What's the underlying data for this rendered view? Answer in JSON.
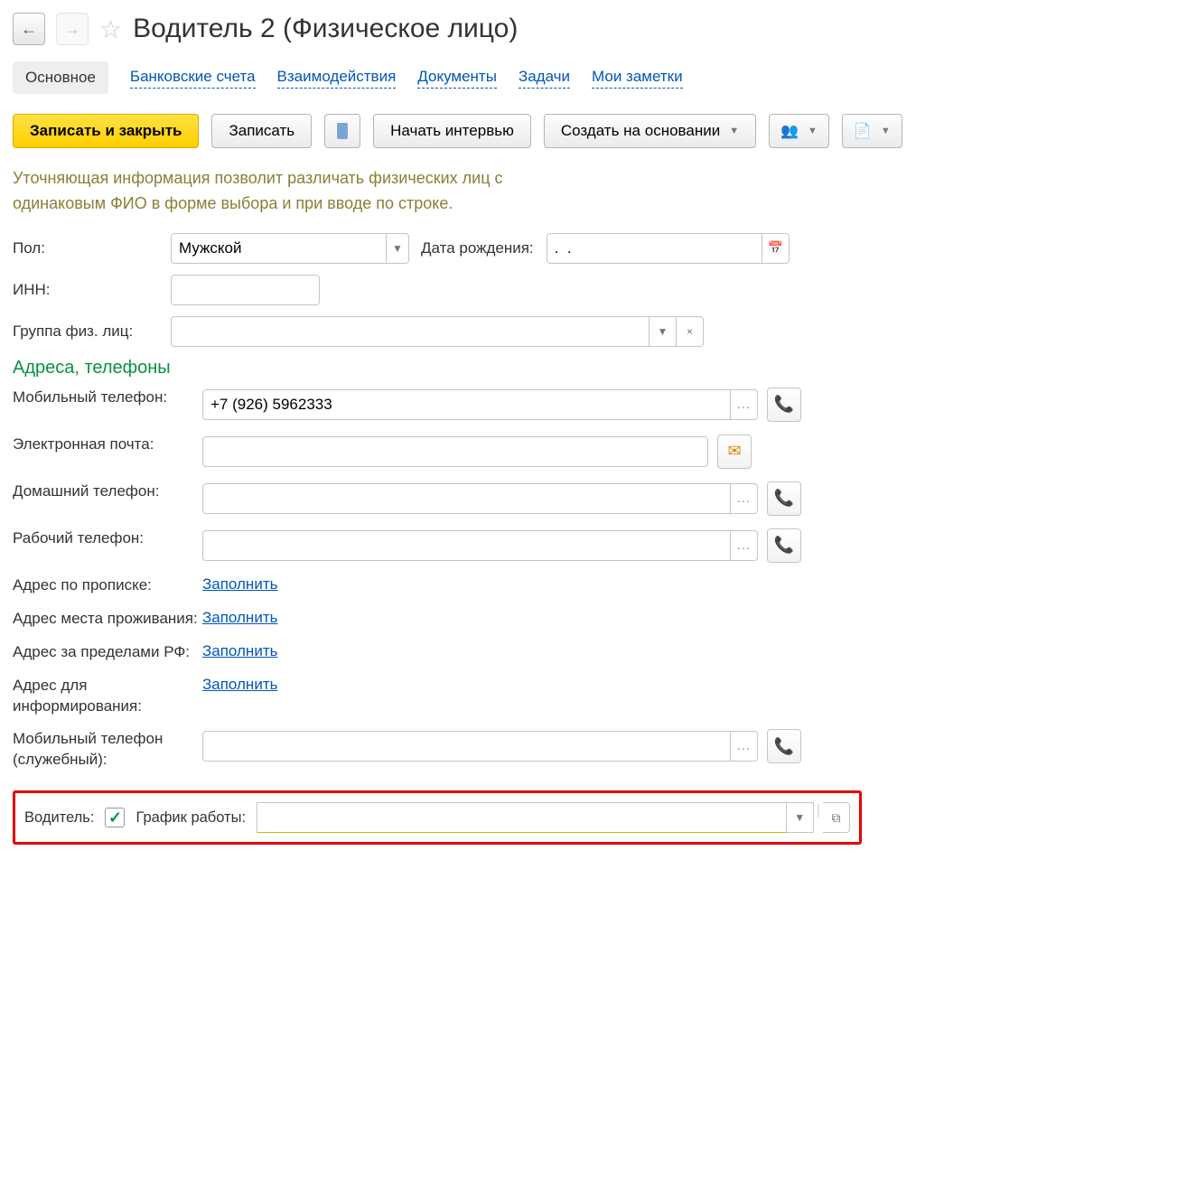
{
  "header": {
    "title": "Водитель 2 (Физическое лицо)"
  },
  "tabs": {
    "active": "Основное",
    "items": [
      "Банковские счета",
      "Взаимодействия",
      "Документы",
      "Задачи",
      "Мои заметки"
    ]
  },
  "toolbar": {
    "save_close": "Записать и закрыть",
    "save": "Записать",
    "start_interview": "Начать интервью",
    "create_basedon": "Создать на основании"
  },
  "info": "Уточняющая информация позволит различать физических лиц  с одинаковым ФИО в форме выбора и при вводе по строке.",
  "form": {
    "gender_label": "Пол:",
    "gender_value": "Мужской",
    "dob_label": "Дата рождения:",
    "dob_value": ".  .",
    "inn_label": "ИНН:",
    "inn_value": "",
    "group_label": "Группа физ. лиц:",
    "group_value": ""
  },
  "contacts": {
    "section": "Адреса, телефоны",
    "mob_label": "Мобильный телефон:",
    "mob_value": "+7 (926) 5962333",
    "email_label": "Электронная почта:",
    "email_value": "",
    "home_label": "Домашний телефон:",
    "home_value": "",
    "work_label": "Рабочий телефон:",
    "work_value": "",
    "addr_reg_label": "Адрес по прописке:",
    "addr_live_label": "Адрес места проживания:",
    "addr_abroad_label": "Адрес за пределами РФ:",
    "addr_notify_label": "Адрес для информирования:",
    "fill_link": "Заполнить",
    "mob_svc_label": "Мобильный телефон (служебный):",
    "mob_svc_value": ""
  },
  "bottom": {
    "driver_label": "Водитель:",
    "driver_checked": true,
    "schedule_label": "График работы:",
    "schedule_value": ""
  }
}
